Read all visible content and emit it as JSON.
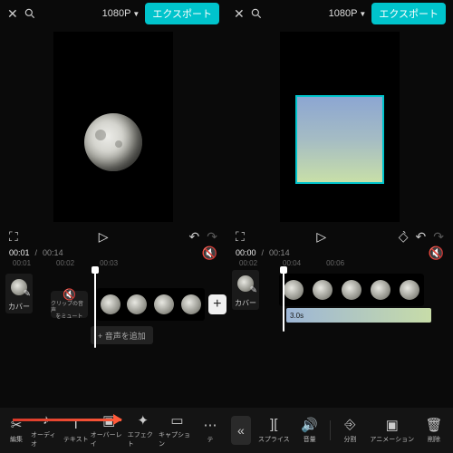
{
  "left": {
    "topbar": {
      "resolution": "1080P",
      "export": "エクスポート"
    },
    "time": {
      "current": "00:01",
      "total": "00:14"
    },
    "ruler": [
      "00:01",
      "00:02",
      "00:03"
    ],
    "mute": {
      "line1": "クリップの音声",
      "line2": "をミュート"
    },
    "cover_label": "カバー",
    "add_audio": "+ 音声を追加",
    "tools": [
      {
        "name": "cut",
        "label": "編集",
        "glyph": "✂"
      },
      {
        "name": "audio",
        "label": "オーディオ",
        "glyph": "♪"
      },
      {
        "name": "text",
        "label": "テキスト",
        "glyph": "T"
      },
      {
        "name": "overlay",
        "label": "オーバーレイ",
        "glyph": "▣"
      },
      {
        "name": "effect",
        "label": "エフェクト",
        "glyph": "✦"
      },
      {
        "name": "caption",
        "label": "キャプション",
        "glyph": "▭"
      },
      {
        "name": "more",
        "label": "テ",
        "glyph": "⋯"
      }
    ]
  },
  "right": {
    "topbar": {
      "resolution": "1080P",
      "export": "エクスポート"
    },
    "time": {
      "current": "00:00",
      "total": "00:14"
    },
    "ruler": [
      "00:02",
      "00:04",
      "00:06"
    ],
    "cover_label": "カバー",
    "overlay_duration": "3.0s",
    "tools": [
      {
        "name": "splice",
        "label": "スプライス",
        "glyph": "▯▯"
      },
      {
        "name": "volume",
        "label": "音量",
        "glyph": "🔊"
      },
      {
        "name": "split",
        "label": "分割",
        "glyph": "▮|▮"
      },
      {
        "name": "anim",
        "label": "アニメーション",
        "glyph": "▣"
      },
      {
        "name": "delete",
        "label": "削除",
        "glyph": "🗑"
      }
    ]
  }
}
